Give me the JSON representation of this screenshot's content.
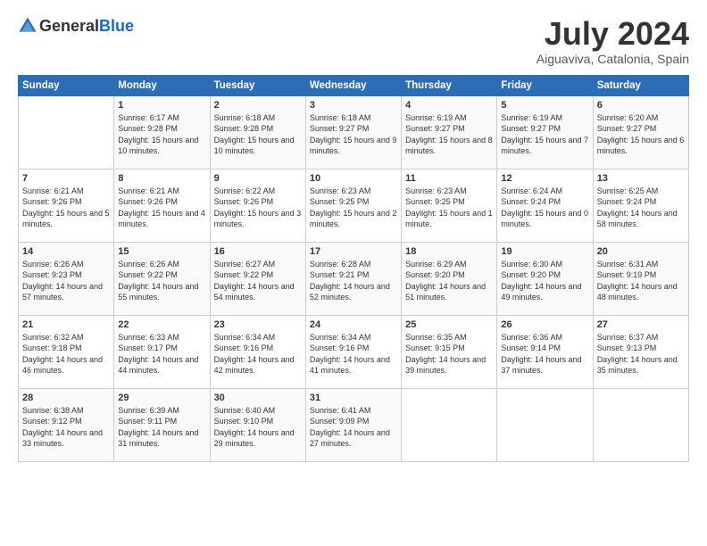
{
  "header": {
    "logo_general": "General",
    "logo_blue": "Blue",
    "month": "July 2024",
    "location": "Aiguaviva, Catalonia, Spain"
  },
  "calendar": {
    "days_of_week": [
      "Sunday",
      "Monday",
      "Tuesday",
      "Wednesday",
      "Thursday",
      "Friday",
      "Saturday"
    ],
    "weeks": [
      [
        {
          "day": "",
          "sunrise": "",
          "sunset": "",
          "daylight": ""
        },
        {
          "day": "1",
          "sunrise": "6:17 AM",
          "sunset": "9:28 PM",
          "daylight": "15 hours and 10 minutes."
        },
        {
          "day": "2",
          "sunrise": "6:18 AM",
          "sunset": "9:28 PM",
          "daylight": "15 hours and 10 minutes."
        },
        {
          "day": "3",
          "sunrise": "6:18 AM",
          "sunset": "9:27 PM",
          "daylight": "15 hours and 9 minutes."
        },
        {
          "day": "4",
          "sunrise": "6:19 AM",
          "sunset": "9:27 PM",
          "daylight": "15 hours and 8 minutes."
        },
        {
          "day": "5",
          "sunrise": "6:19 AM",
          "sunset": "9:27 PM",
          "daylight": "15 hours and 7 minutes."
        },
        {
          "day": "6",
          "sunrise": "6:20 AM",
          "sunset": "9:27 PM",
          "daylight": "15 hours and 6 minutes."
        }
      ],
      [
        {
          "day": "7",
          "sunrise": "6:21 AM",
          "sunset": "9:26 PM",
          "daylight": "15 hours and 5 minutes."
        },
        {
          "day": "8",
          "sunrise": "6:21 AM",
          "sunset": "9:26 PM",
          "daylight": "15 hours and 4 minutes."
        },
        {
          "day": "9",
          "sunrise": "6:22 AM",
          "sunset": "9:26 PM",
          "daylight": "15 hours and 3 minutes."
        },
        {
          "day": "10",
          "sunrise": "6:23 AM",
          "sunset": "9:25 PM",
          "daylight": "15 hours and 2 minutes."
        },
        {
          "day": "11",
          "sunrise": "6:23 AM",
          "sunset": "9:25 PM",
          "daylight": "15 hours and 1 minute."
        },
        {
          "day": "12",
          "sunrise": "6:24 AM",
          "sunset": "9:24 PM",
          "daylight": "15 hours and 0 minutes."
        },
        {
          "day": "13",
          "sunrise": "6:25 AM",
          "sunset": "9:24 PM",
          "daylight": "14 hours and 58 minutes."
        }
      ],
      [
        {
          "day": "14",
          "sunrise": "6:26 AM",
          "sunset": "9:23 PM",
          "daylight": "14 hours and 57 minutes."
        },
        {
          "day": "15",
          "sunrise": "6:26 AM",
          "sunset": "9:22 PM",
          "daylight": "14 hours and 55 minutes."
        },
        {
          "day": "16",
          "sunrise": "6:27 AM",
          "sunset": "9:22 PM",
          "daylight": "14 hours and 54 minutes."
        },
        {
          "day": "17",
          "sunrise": "6:28 AM",
          "sunset": "9:21 PM",
          "daylight": "14 hours and 52 minutes."
        },
        {
          "day": "18",
          "sunrise": "6:29 AM",
          "sunset": "9:20 PM",
          "daylight": "14 hours and 51 minutes."
        },
        {
          "day": "19",
          "sunrise": "6:30 AM",
          "sunset": "9:20 PM",
          "daylight": "14 hours and 49 minutes."
        },
        {
          "day": "20",
          "sunrise": "6:31 AM",
          "sunset": "9:19 PM",
          "daylight": "14 hours and 48 minutes."
        }
      ],
      [
        {
          "day": "21",
          "sunrise": "6:32 AM",
          "sunset": "9:18 PM",
          "daylight": "14 hours and 46 minutes."
        },
        {
          "day": "22",
          "sunrise": "6:33 AM",
          "sunset": "9:17 PM",
          "daylight": "14 hours and 44 minutes."
        },
        {
          "day": "23",
          "sunrise": "6:34 AM",
          "sunset": "9:16 PM",
          "daylight": "14 hours and 42 minutes."
        },
        {
          "day": "24",
          "sunrise": "6:34 AM",
          "sunset": "9:16 PM",
          "daylight": "14 hours and 41 minutes."
        },
        {
          "day": "25",
          "sunrise": "6:35 AM",
          "sunset": "9:15 PM",
          "daylight": "14 hours and 39 minutes."
        },
        {
          "day": "26",
          "sunrise": "6:36 AM",
          "sunset": "9:14 PM",
          "daylight": "14 hours and 37 minutes."
        },
        {
          "day": "27",
          "sunrise": "6:37 AM",
          "sunset": "9:13 PM",
          "daylight": "14 hours and 35 minutes."
        }
      ],
      [
        {
          "day": "28",
          "sunrise": "6:38 AM",
          "sunset": "9:12 PM",
          "daylight": "14 hours and 33 minutes."
        },
        {
          "day": "29",
          "sunrise": "6:39 AM",
          "sunset": "9:11 PM",
          "daylight": "14 hours and 31 minutes."
        },
        {
          "day": "30",
          "sunrise": "6:40 AM",
          "sunset": "9:10 PM",
          "daylight": "14 hours and 29 minutes."
        },
        {
          "day": "31",
          "sunrise": "6:41 AM",
          "sunset": "9:09 PM",
          "daylight": "14 hours and 27 minutes."
        },
        {
          "day": "",
          "sunrise": "",
          "sunset": "",
          "daylight": ""
        },
        {
          "day": "",
          "sunrise": "",
          "sunset": "",
          "daylight": ""
        },
        {
          "day": "",
          "sunrise": "",
          "sunset": "",
          "daylight": ""
        }
      ]
    ]
  }
}
